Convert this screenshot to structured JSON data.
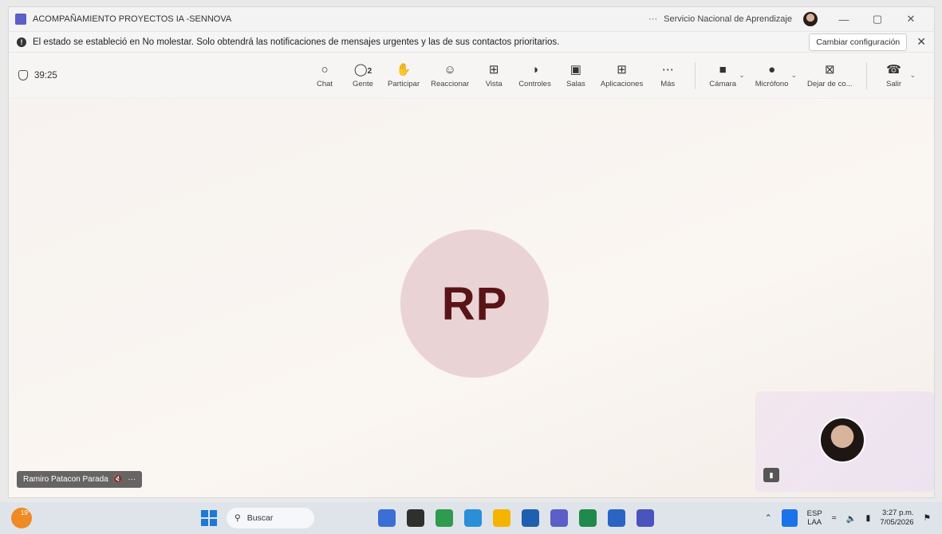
{
  "window": {
    "title": "ACOMPAÑAMIENTO PROYECTOS IA -SENNOVA",
    "more": "···",
    "org": "Servicio Nacional de Aprendizaje",
    "min": "—",
    "max": "▢",
    "close": "✕"
  },
  "notice": {
    "text": "El estado se estableció en No molestar. Solo obtendrá las notificaciones de mensajes urgentes y las de sus contactos prioritarios.",
    "button": "Cambiar configuración",
    "close": "✕"
  },
  "meeting": {
    "timer": "39:25",
    "tools": {
      "chat": "Chat",
      "people": "Gente",
      "people_count": "2",
      "raise": "Participar",
      "react": "Reaccionar",
      "view": "Vista",
      "controls": "Controles",
      "rooms": "Salas",
      "apps": "Aplicaciones",
      "more": "Más",
      "camera": "Cámara",
      "mic": "Micrófono",
      "share": "Dejar de co...",
      "leave": "Salir"
    }
  },
  "stage": {
    "initials": "RP",
    "participant_name": "Ramiro Patacon Parada",
    "name_menu": "···"
  },
  "taskbar": {
    "temp": "19°",
    "search": "Buscar",
    "lang_top": "ESP",
    "lang_bottom": "LAA",
    "time": "3:27 p.m.",
    "date": "7/05/2026"
  }
}
